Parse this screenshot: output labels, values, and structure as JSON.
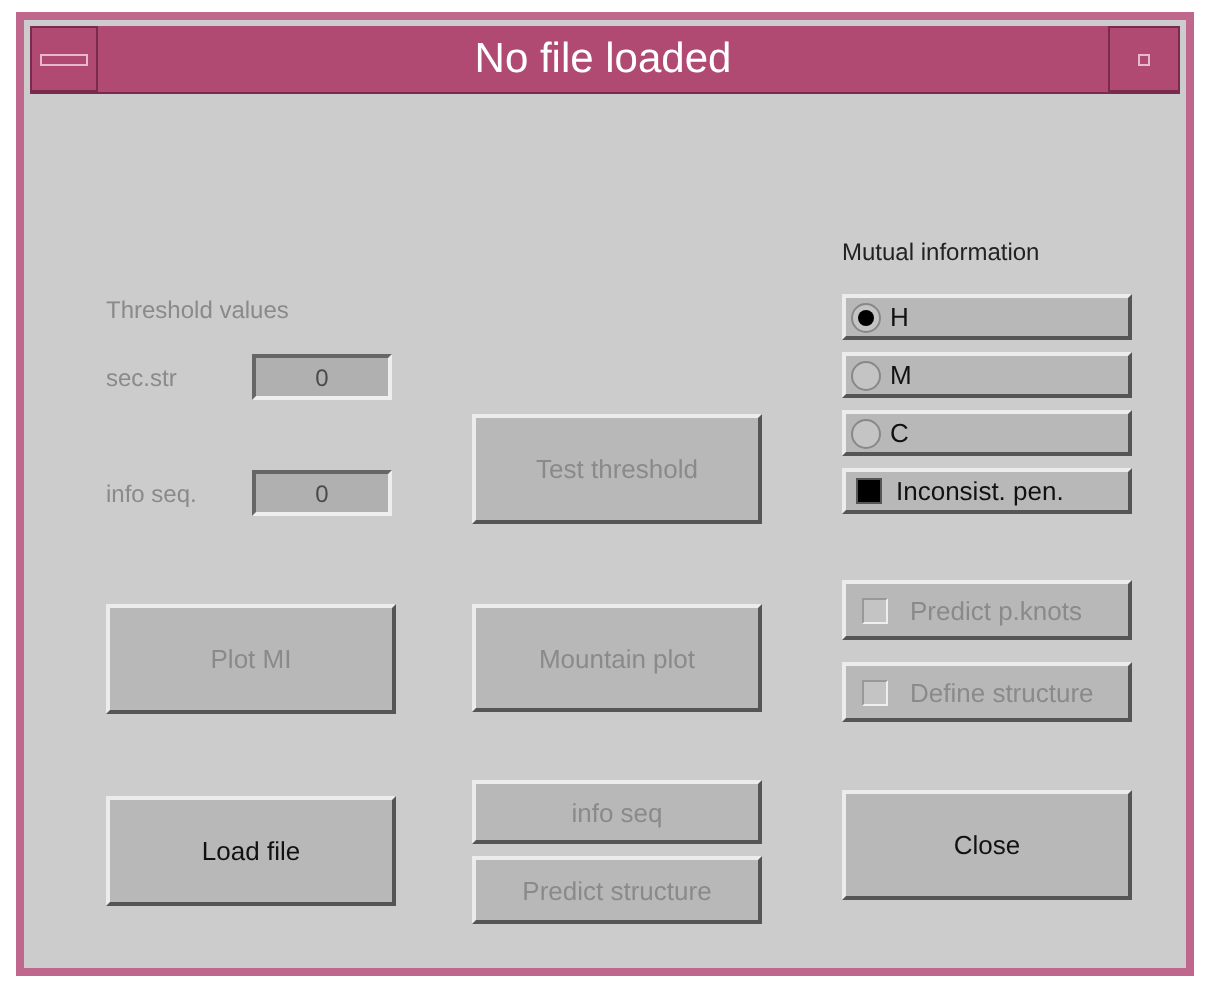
{
  "window": {
    "title": "No file loaded"
  },
  "threshold": {
    "label": "Threshold values",
    "disabled": true,
    "fields": [
      {
        "label": "sec.str",
        "value": "0",
        "disabled": true
      },
      {
        "label": "info seq.",
        "value": "0",
        "disabled": true
      }
    ]
  },
  "left_buttons": [
    {
      "label": "Plot MI",
      "disabled": true
    },
    {
      "label": "Load file",
      "disabled": false
    }
  ],
  "middle_buttons": [
    {
      "label": "Test threshold",
      "disabled": true
    },
    {
      "label": "Mountain plot",
      "disabled": true
    },
    {
      "label": "info seq",
      "disabled": true
    },
    {
      "label": "Predict structure",
      "disabled": true
    }
  ],
  "mutual_information": {
    "label": "Mutual information",
    "options": [
      {
        "label": "H",
        "kind": "radio",
        "selected": true
      },
      {
        "label": "M",
        "kind": "radio",
        "selected": false
      },
      {
        "label": "C",
        "kind": "radio",
        "selected": false
      },
      {
        "label": "Inconsist. pen.",
        "kind": "checkbox",
        "checked": true
      }
    ]
  },
  "options": [
    {
      "label": "Predict p.knots",
      "checked": false,
      "disabled": true
    },
    {
      "label": "Define structure",
      "checked": false,
      "disabled": true
    }
  ],
  "close_button": {
    "label": "Close",
    "disabled": false
  }
}
